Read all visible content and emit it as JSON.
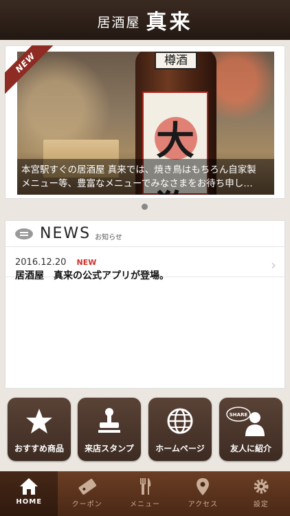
{
  "header": {
    "title_prefix": "居酒屋",
    "title_main": "真来"
  },
  "hero": {
    "badge": "NEW",
    "bottle_label": "樽酒",
    "bottle_brand": "大狗",
    "caption_line1": "本宮駅すぐの居酒屋 真来では、焼き鳥はもちろん自家製",
    "caption_line2": "メニュー等、豊富なメニューでみなさまをお待ち申し…"
  },
  "news": {
    "title": "NEWS",
    "subtitle": "お知らせ",
    "items": [
      {
        "date": "2016.12.20",
        "badge": "NEW",
        "text": "居酒屋　真来の公式アプリが登場。"
      }
    ]
  },
  "tiles": [
    {
      "label": "おすすめ商品",
      "icon": "star-icon"
    },
    {
      "label": "来店スタンプ",
      "icon": "stamp-icon"
    },
    {
      "label": "ホームページ",
      "icon": "globe-icon"
    },
    {
      "label": "友人に紹介",
      "icon": "share-user-icon",
      "icon_text": "SHARE"
    }
  ],
  "tabs": [
    {
      "label": "HOME",
      "icon": "home-icon",
      "active": true
    },
    {
      "label": "クーポン",
      "icon": "coupon-icon"
    },
    {
      "label": "メニュー",
      "icon": "cutlery-icon"
    },
    {
      "label": "アクセス",
      "icon": "map-pin-icon"
    },
    {
      "label": "設定",
      "icon": "gear-icon"
    }
  ],
  "colors": {
    "brand_brown": "#3d2b22",
    "accent_red": "#d0302a",
    "tabbar": "#5a3320"
  }
}
